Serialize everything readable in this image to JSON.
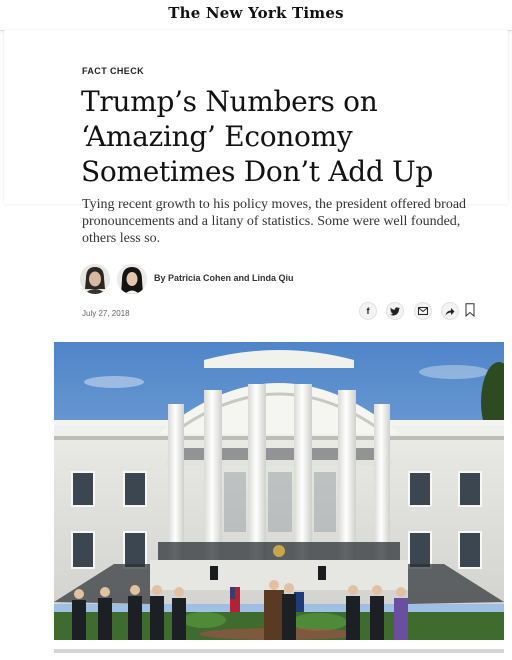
{
  "masthead": {
    "title": "The New York Times"
  },
  "article": {
    "kicker": "Fact Check",
    "headline_lines": [
      "Trump’s Numbers on",
      "‘Amazing’ Economy",
      "Sometimes Don’t Add Up"
    ],
    "summary": "Tying recent growth to his policy moves, the president offered broad pronouncements and a litany of statistics. Some were well founded, others less so.",
    "byline_prefix": "By",
    "authors": "Patricia Cohen and Linda Qiu",
    "date": "July 27, 2018"
  },
  "share_buttons": [
    {
      "icon": "facebook-icon",
      "glyph": "f"
    },
    {
      "icon": "twitter-icon",
      "glyph": "🐦"
    },
    {
      "icon": "email-icon",
      "glyph": "✉"
    },
    {
      "icon": "share-arrow-icon",
      "glyph": "➦"
    },
    {
      "icon": "bookmark-icon",
      "glyph": ""
    }
  ],
  "colors": {
    "text": "#121212",
    "sky": "#7da4d8",
    "building": "#f4f4f2",
    "lawn": "#3f6b2f"
  }
}
